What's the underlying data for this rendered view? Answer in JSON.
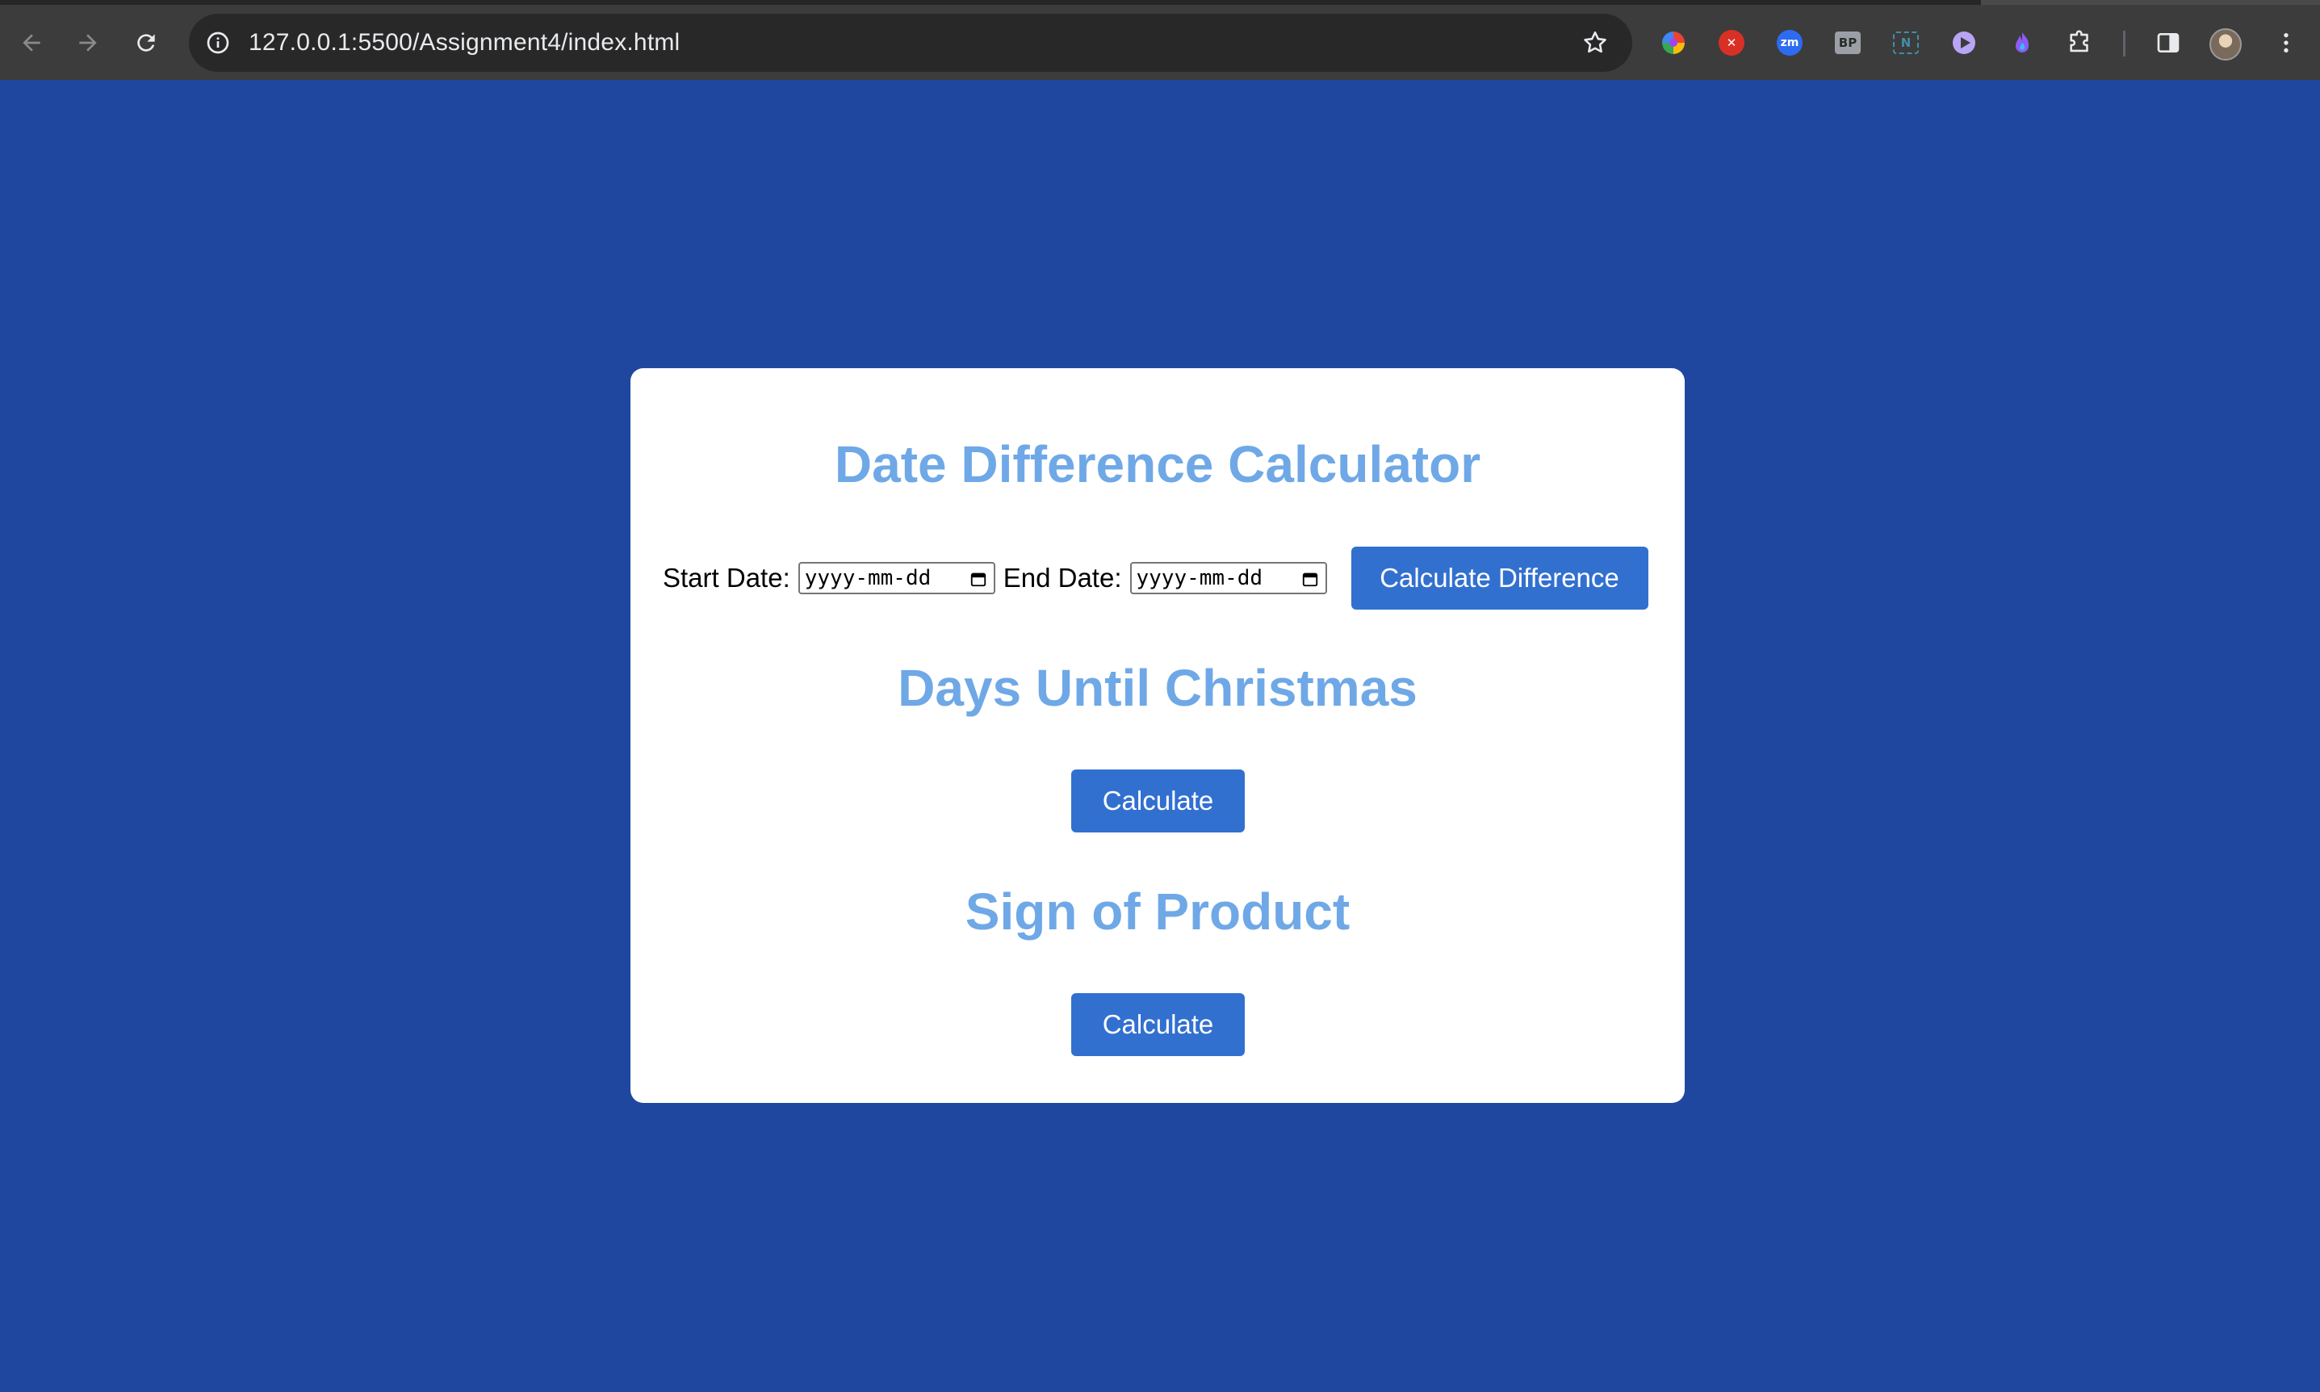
{
  "browser": {
    "url": "127.0.0.1:5500/Assignment4/index.html",
    "extensions": [
      "colorful-wheel-icon",
      "red-x-icon",
      "zm-icon",
      "bp-icon",
      "notion-icon",
      "play-icon",
      "flame-icon",
      "puzzle-icon"
    ],
    "ext_zm_label": "zm",
    "ext_bp_label": "BP",
    "ext_n_label": "N"
  },
  "colors": {
    "page_background": "#2047a0",
    "heading": "#6fa8e6",
    "button": "#3270d0",
    "card": "#ffffff"
  },
  "date_difference": {
    "title": "Date Difference Calculator",
    "start_label": "Start Date:",
    "start_placeholder": "yyyy-mm-dd",
    "end_label": "End Date:",
    "end_placeholder": "yyyy-mm-dd",
    "button_label": "Calculate Difference"
  },
  "christmas": {
    "title": "Days Until Christmas",
    "button_label": "Calculate"
  },
  "product_sign": {
    "title": "Sign of Product",
    "button_label": "Calculate"
  }
}
